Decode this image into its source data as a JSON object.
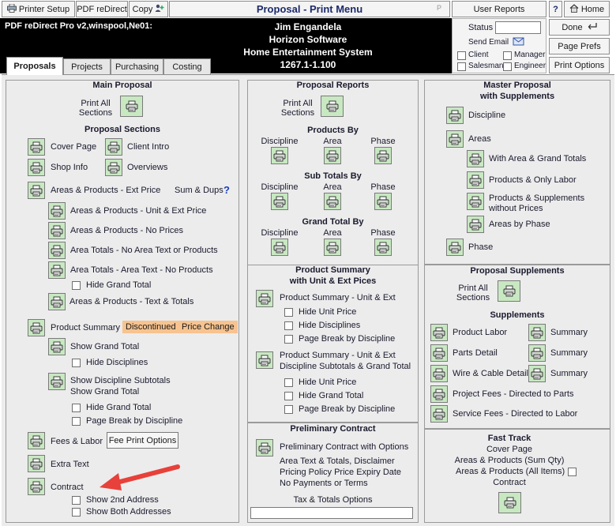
{
  "toolbar": {
    "printer_setup": "Printer Setup",
    "pdf_redirect": "PDF reDirect",
    "copy": "Copy",
    "title": "Proposal - Print Menu",
    "title_marker": "P",
    "user_reports": "User Reports",
    "help": "?",
    "home": "Home"
  },
  "header": {
    "printer_info": "PDF reDirect Pro v2,winspool,Ne01:",
    "lines": [
      "Jim Engandela",
      "Horizon Software",
      "Home Entertainment System",
      "1267.1-1.100"
    ]
  },
  "status_panel": {
    "status_label": "Status",
    "status_value": "",
    "send_email": "Send Email",
    "client": "Client",
    "manager": "Manager",
    "salesman": "Salesman",
    "engineer": "Engineer"
  },
  "right_buttons": {
    "done": "Done",
    "page_prefs": "Page Prefs",
    "print_options": "Print Options"
  },
  "tabs": [
    "Proposals",
    "Projects",
    "Purchasing",
    "Costing"
  ],
  "main_proposal": {
    "title": "Main Proposal",
    "print_all": "Print All\nSections",
    "print_all_1": "Print All",
    "print_all_2": "Sections",
    "sections_title": "Proposal Sections",
    "cover_page": "Cover Page",
    "client_intro": "Client Intro",
    "shop_info": "Shop Info",
    "overviews": "Overviews",
    "areas_products_ext": "Areas & Products - Ext Price",
    "sum_dups": "Sum & Dups",
    "sum_dups_help": "?",
    "ap_unit_ext": "Areas & Products - Unit & Ext Price",
    "ap_no_prices": "Areas & Products - No Prices",
    "area_totals_no_text": "Area Totals - No Area Text or Products",
    "area_totals_text": "Area Totals - Area Text - No Products",
    "hide_grand_total": "Hide Grand Total",
    "ap_text_totals": "Areas & Products - Text & Totals",
    "product_summary": "Product Summary",
    "discontinued": "Discontinued",
    "price_change": "Price Change",
    "show_grand_total": "Show Grand Total",
    "hide_disciplines": "Hide Disciplines",
    "show_disc_subtotals_1": "Show Discipline Subtotals",
    "show_disc_subtotals_2": "Show Grand Total",
    "hide_grand_total_2": "Hide Grand Total",
    "page_break_discipline": "Page Break by Discipline",
    "fees_labor": "Fees & Labor",
    "fee_print_options": "Fee Print Options",
    "extra_text": "Extra Text",
    "contract": "Contract",
    "show_2nd_address": "Show 2nd Address",
    "show_both_addresses": "Show Both Addresses"
  },
  "proposal_reports": {
    "title": "Proposal Reports",
    "print_all_1": "Print All",
    "print_all_2": "Sections",
    "products_by": "Products By",
    "sub_totals_by": "Sub Totals By",
    "grand_total_by": "Grand Total By",
    "discipline": "Discipline",
    "area": "Area",
    "phase": "Phase",
    "ps_title_1": "Product Summary",
    "ps_title_2": "with Unit & Ext Pices",
    "ps_unit_ext": "Product Summary - Unit & Ext",
    "hide_unit_price": "Hide Unit Price",
    "hide_disciplines": "Hide Disciplines",
    "page_break_discipline": "Page Break by Discipline",
    "ps_unit_ext_2a": "Product Summary - Unit & Ext",
    "ps_unit_ext_2b": "Discipline Subtotals & Grand Total",
    "hide_unit_price_2": "Hide Unit Price",
    "hide_grand_total": "Hide Grand Total",
    "page_break_discipline_2": "Page Break by Discipline",
    "preliminary_title": "Preliminary Contract",
    "preliminary_options": "Preliminary Contract with Options",
    "prelim_line_1": "Area Text & Totals, Disclaimer",
    "prelim_line_2": "Pricing Policy Price Expiry Date",
    "prelim_line_3": "No Payments or Terms",
    "tax_totals_options": "Tax & Totals Options"
  },
  "master_proposal": {
    "title_1": "Master Proposal",
    "title_2": "with Supplements",
    "discipline": "Discipline",
    "areas": "Areas",
    "with_area_grand": "With Area & Grand Totals",
    "products_only_labor": "Products & Only Labor",
    "products_supp_1": "Products & Supplements",
    "products_supp_2": "without Prices",
    "areas_by_phase": "Areas by Phase",
    "phase": "Phase",
    "supp_title": "Proposal Supplements",
    "print_all_1": "Print All",
    "print_all_2": "Sections",
    "supplements": "Supplements",
    "product_labor": "Product Labor",
    "parts_detail": "Parts Detail",
    "wire_cable_detail": "Wire & Cable Detail",
    "summary": "Summary",
    "project_fees": "Project Fees - Directed to Parts",
    "service_fees": "Service Fees - Directed to Labor",
    "fast_track": "Fast Track",
    "ft_cover_page": "Cover Page",
    "ft_areas_sum_qty": "Areas & Products (Sum Qty)",
    "ft_areas_all_items": "Areas & Products (All Items)",
    "ft_contract": "Contract"
  },
  "colors": {
    "print_button": "#c8e8c2",
    "orange_badge": "#f7c38f",
    "title_blue": "#1b2a6b",
    "arrow_red": "#e8403a"
  }
}
